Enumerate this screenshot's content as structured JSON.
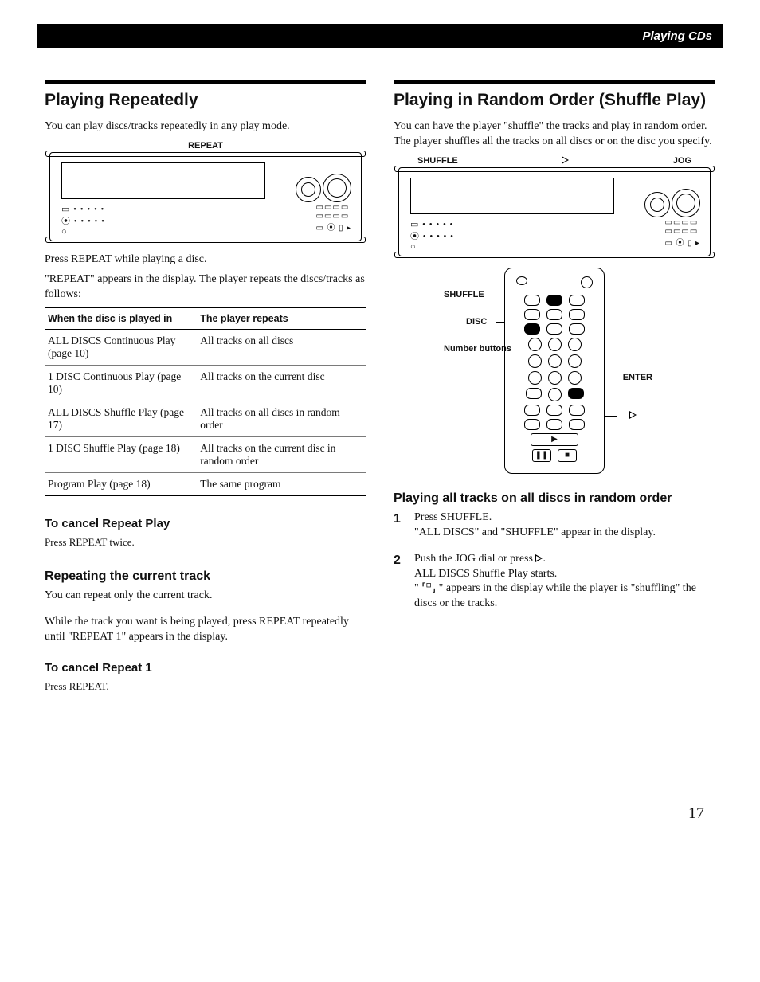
{
  "header": {
    "section": "Playing CDs"
  },
  "left": {
    "title": "Playing Repeatedly",
    "intro": "You can play discs/tracks repeatedly in any play mode.",
    "device_label": "REPEAT",
    "after_device_1": "Press REPEAT while playing a disc.",
    "after_device_2": "\"REPEAT\" appears in the display. The player repeats the discs/tracks as follows:",
    "table": {
      "h1": "When the disc is played in",
      "h2": "The player repeats",
      "rows": [
        {
          "a": "ALL DISCS Continuous Play (page 10)",
          "b": "All tracks on all discs"
        },
        {
          "a": "1 DISC Continuous Play (page 10)",
          "b": "All tracks on the current disc"
        },
        {
          "a": "ALL DISCS Shuffle Play (page 17)",
          "b": "All tracks on all discs in random order"
        },
        {
          "a": "1 DISC Shuffle Play (page 18)",
          "b": "All tracks on the current disc in random order"
        },
        {
          "a": "Program Play (page 18)",
          "b": "The same program"
        }
      ]
    },
    "cancel_repeat_h": "To cancel Repeat Play",
    "cancel_repeat_p": "Press REPEAT twice.",
    "sub_h": "Repeating the current track",
    "sub_p1": "You can repeat only the current track.",
    "sub_p2": "While the track you want is being played, press REPEAT repeatedly until \"REPEAT 1\" appears in the display.",
    "cancel1_h": "To cancel Repeat 1",
    "cancel1_p": "Press REPEAT."
  },
  "right": {
    "title": "Playing in Random Order (Shuffle Play)",
    "intro": "You can have the player \"shuffle\" the tracks and play in random order. The player shuffles all the tracks on all discs or on the disc you specify.",
    "dev_labels": {
      "l": "SHUFFLE",
      "c": "▷",
      "r": "JOG"
    },
    "remote_labels": {
      "shuffle": "SHUFFLE",
      "disc": "DISC",
      "numbers": "Number buttons",
      "enter": "ENTER",
      "play": "▷"
    },
    "sub_h": "Playing all tracks on all discs in random order",
    "steps": [
      {
        "l1": "Press SHUFFLE.",
        "l2": "\"ALL DISCS\" and \"SHUFFLE\" appear in the display."
      },
      {
        "l1": "Push the JOG dial or press ▷.",
        "l2": "ALL DISCS Shuffle Play starts.",
        "l3": "\" ⸢⸋⸥ \" appears in the display while the player is \"shuffling\" the discs or the tracks."
      }
    ]
  },
  "page_number": "17"
}
